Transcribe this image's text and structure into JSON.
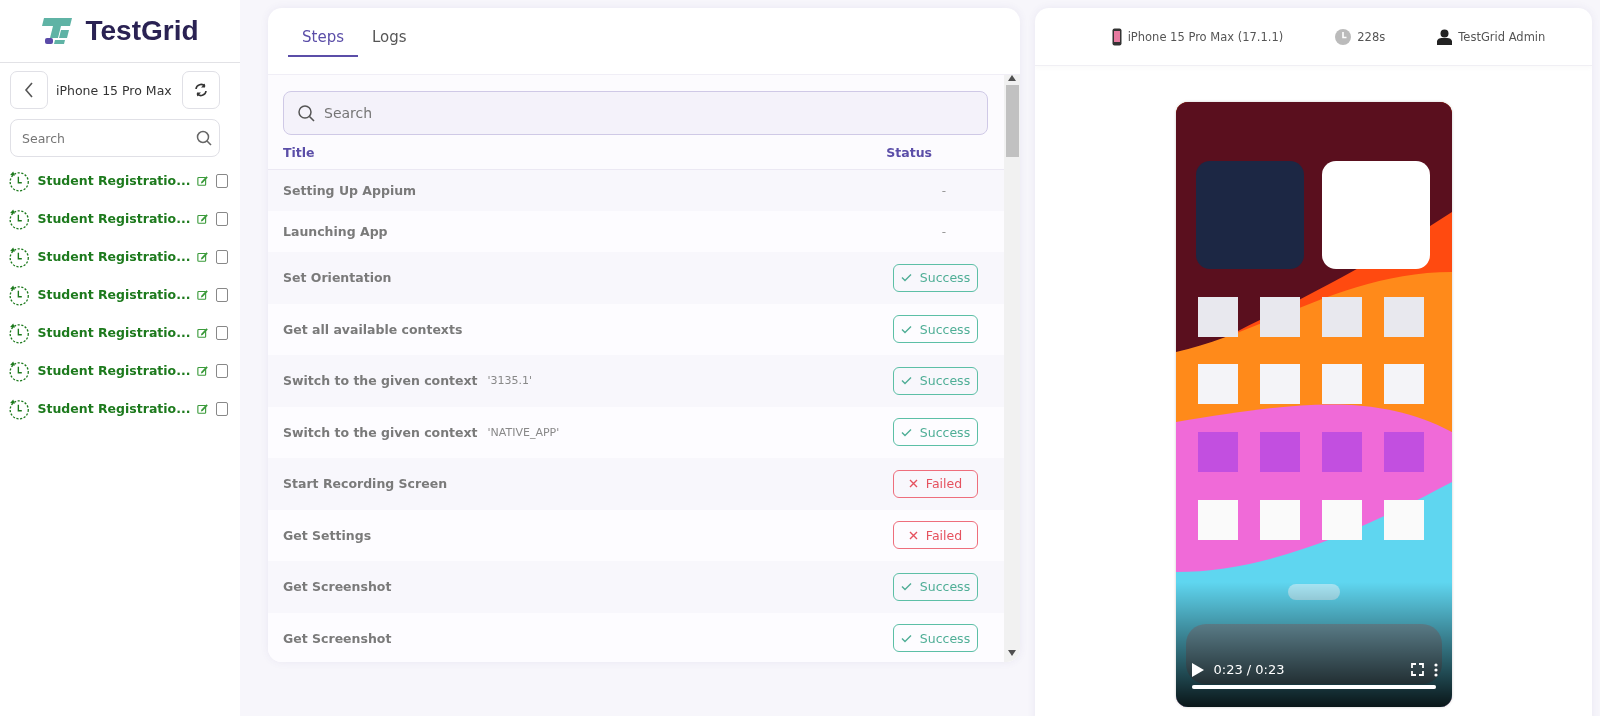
{
  "logo": {
    "text": "TestGrid"
  },
  "device_bar": {
    "name": "iPhone 15 Pro Max"
  },
  "sidebar_search": {
    "placeholder": "Search"
  },
  "runs": [
    {
      "title": "Student Registratio...",
      "checked": false
    },
    {
      "title": "Student Registratio...",
      "checked": false
    },
    {
      "title": "Student Registratio...",
      "checked": false
    },
    {
      "title": "Student Registratio...",
      "checked": false
    },
    {
      "title": "Student Registratio...",
      "checked": false
    },
    {
      "title": "Student Registratio...",
      "checked": false
    },
    {
      "title": "Student Registratio...",
      "checked": false
    }
  ],
  "tabs": [
    {
      "label": "Steps",
      "selected": true
    },
    {
      "label": "Logs",
      "selected": false
    }
  ],
  "step_search": {
    "placeholder": "Search"
  },
  "table": {
    "columns": [
      "Title",
      "Status"
    ],
    "rows": [
      {
        "title": "Setting Up Appium",
        "kind": "none",
        "status": "-"
      },
      {
        "title": "Launching App",
        "kind": "none",
        "status": "-"
      },
      {
        "title": "Set Orientation",
        "kind": "success",
        "status": "Success"
      },
      {
        "title": "Get all available contexts",
        "kind": "success",
        "status": "Success"
      },
      {
        "title": "Switch to the given context",
        "detail": "'3135.1'",
        "kind": "success",
        "status": "Success"
      },
      {
        "title": "Switch to the given context",
        "detail": "'NATIVE_APP'",
        "kind": "success",
        "status": "Success"
      },
      {
        "title": "Start Recording Screen",
        "kind": "failed",
        "status": "Failed"
      },
      {
        "title": "Get Settings",
        "kind": "failed",
        "status": "Failed"
      },
      {
        "title": "Get Screenshot",
        "kind": "success",
        "status": "Success"
      },
      {
        "title": "Get Screenshot",
        "kind": "success",
        "status": "Success"
      }
    ]
  },
  "device_info": {
    "device": "iPhone 15 Pro Max (17.1.1)",
    "duration": "228s",
    "user": "TestGrid Admin"
  },
  "video": {
    "kind": "picture",
    "time": "0:23 / 0:23",
    "level": 1
  }
}
